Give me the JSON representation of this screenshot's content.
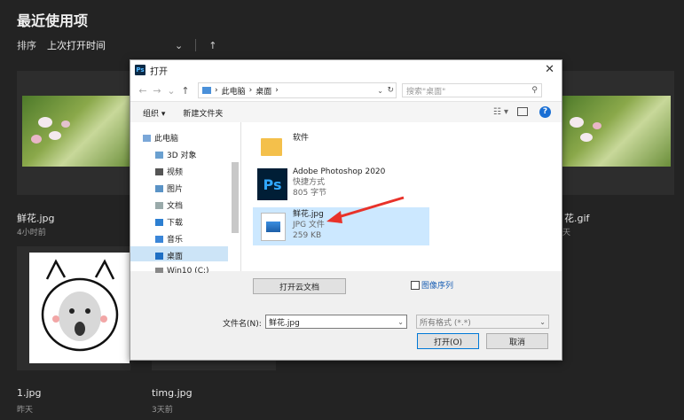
{
  "background": {
    "title": "最近使用项",
    "sort_label": "排序",
    "sort_value": "上次打开时间",
    "cards": [
      {
        "name": "鲜花.jpg",
        "time": "4小时前"
      },
      {
        "name": "花.gif",
        "time": "天"
      },
      {
        "name": "1.jpg",
        "time": "昨天"
      },
      {
        "name": "timg.jpg",
        "time": "3天前"
      }
    ]
  },
  "dialog": {
    "title": "打开",
    "app_icon": "Ps",
    "breadcrumb": [
      "此电脑",
      "桌面"
    ],
    "search_placeholder": "搜索\"桌面\"",
    "toolbar": {
      "organize": "组织 ▾",
      "new_folder": "新建文件夹"
    },
    "nav": [
      {
        "label": "此电脑"
      },
      {
        "label": "3D 对象"
      },
      {
        "label": "视频"
      },
      {
        "label": "图片"
      },
      {
        "label": "文档"
      },
      {
        "label": "下载"
      },
      {
        "label": "音乐"
      },
      {
        "label": "桌面"
      },
      {
        "label": "Win10 (C:)"
      }
    ],
    "files": [
      {
        "name": "软件"
      },
      {
        "name": "Adobe Photoshop 2020",
        "type": "快捷方式",
        "size": "805 字节"
      },
      {
        "name": "鲜花.jpg",
        "type": "JPG 文件",
        "size": "259 KB"
      }
    ],
    "cloud_button": "打开云文档",
    "sequence_label": "图像序列",
    "filename_label": "文件名(N):",
    "filename_value": "鲜花.jpg",
    "filetype_value": "所有格式 (*.*)",
    "open_button": "打开(O)",
    "cancel_button": "取消"
  },
  "colors": {
    "accent": "#0078d7",
    "selection": "#cce8ff",
    "annotation": "#e8322a"
  }
}
